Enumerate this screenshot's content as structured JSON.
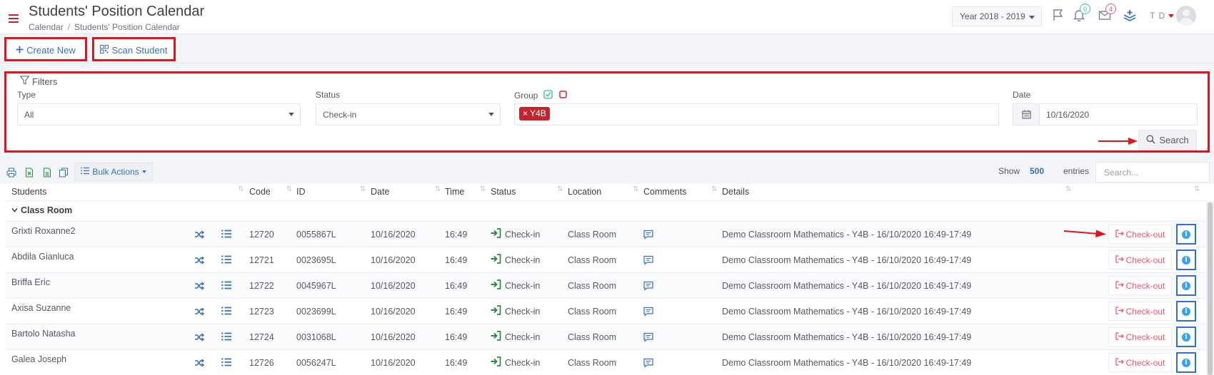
{
  "header": {
    "title": "Students' Position Calendar",
    "breadcrumb": [
      "Calendar",
      "Students' Position Calendar"
    ],
    "breadcrumb_sep": "/",
    "year_select": "Year 2018 - 2019",
    "notifications_count": "0",
    "messages_count": "4",
    "user_initials": "T D"
  },
  "toolbar": {
    "create_new_label": "Create New",
    "scan_student_label": "Scan Student"
  },
  "filters": {
    "legend": "Filters",
    "type_label": "Type",
    "type_value": "All",
    "status_label": "Status",
    "status_value": "Check-in",
    "group_label": "Group",
    "group_tags": [
      "Y4B"
    ],
    "date_label": "Date",
    "date_value": "10/16/2020",
    "search_label": "Search"
  },
  "table_toolbar": {
    "bulk_actions_label": "Bulk Actions",
    "show_label": "Show",
    "show_value": "500",
    "entries_label": "entries",
    "search_placeholder": "Search..."
  },
  "table": {
    "columns": [
      "Students",
      "Code",
      "ID",
      "Date",
      "Time",
      "Status",
      "Location",
      "Comments",
      "Details"
    ],
    "group_name": "Class Room",
    "checkout_label": "Check-out",
    "rows": [
      {
        "student": "Grixti Roxanne2",
        "code": "12720",
        "id": "0055867L",
        "date": "10/16/2020",
        "time": "16:49",
        "status": "Check-in",
        "location": "Class Room",
        "details": "Demo Classroom Mathematics - Y4B - 16/10/2020 16:49-17:49"
      },
      {
        "student": "Abdila Gianluca",
        "code": "12721",
        "id": "0023695L",
        "date": "10/16/2020",
        "time": "16:49",
        "status": "Check-in",
        "location": "Class Room",
        "details": "Demo Classroom Mathematics - Y4B - 16/10/2020 16:49-17:49"
      },
      {
        "student": "Briffa Eric",
        "code": "12722",
        "id": "0045967L",
        "date": "10/16/2020",
        "time": "16:49",
        "status": "Check-in",
        "location": "Class Room",
        "details": "Demo Classroom Mathematics - Y4B - 16/10/2020 16:49-17:49"
      },
      {
        "student": "Axisa Suzanne",
        "code": "12723",
        "id": "0023699L",
        "date": "10/16/2020",
        "time": "16:49",
        "status": "Check-in",
        "location": "Class Room",
        "details": "Demo Classroom Mathematics - Y4B - 16/10/2020 16:49-17:49"
      },
      {
        "student": "Bartolo Natasha",
        "code": "12724",
        "id": "0031068L",
        "date": "10/16/2020",
        "time": "16:49",
        "status": "Check-in",
        "location": "Class Room",
        "details": "Demo Classroom Mathematics - Y4B - 16/10/2020 16:49-17:49"
      },
      {
        "student": "Galea Joseph",
        "code": "12726",
        "id": "0056247L",
        "date": "10/16/2020",
        "time": "16:49",
        "status": "Check-in",
        "location": "Class Room",
        "details": "Demo Classroom Mathematics - Y4B - 16/10/2020 16:49-17:49"
      }
    ]
  },
  "colors": {
    "accent_red": "#c0262d",
    "link_blue": "#3b6fb6",
    "checkin_green": "#2a8c3a",
    "checkout_red": "#f4516c"
  }
}
